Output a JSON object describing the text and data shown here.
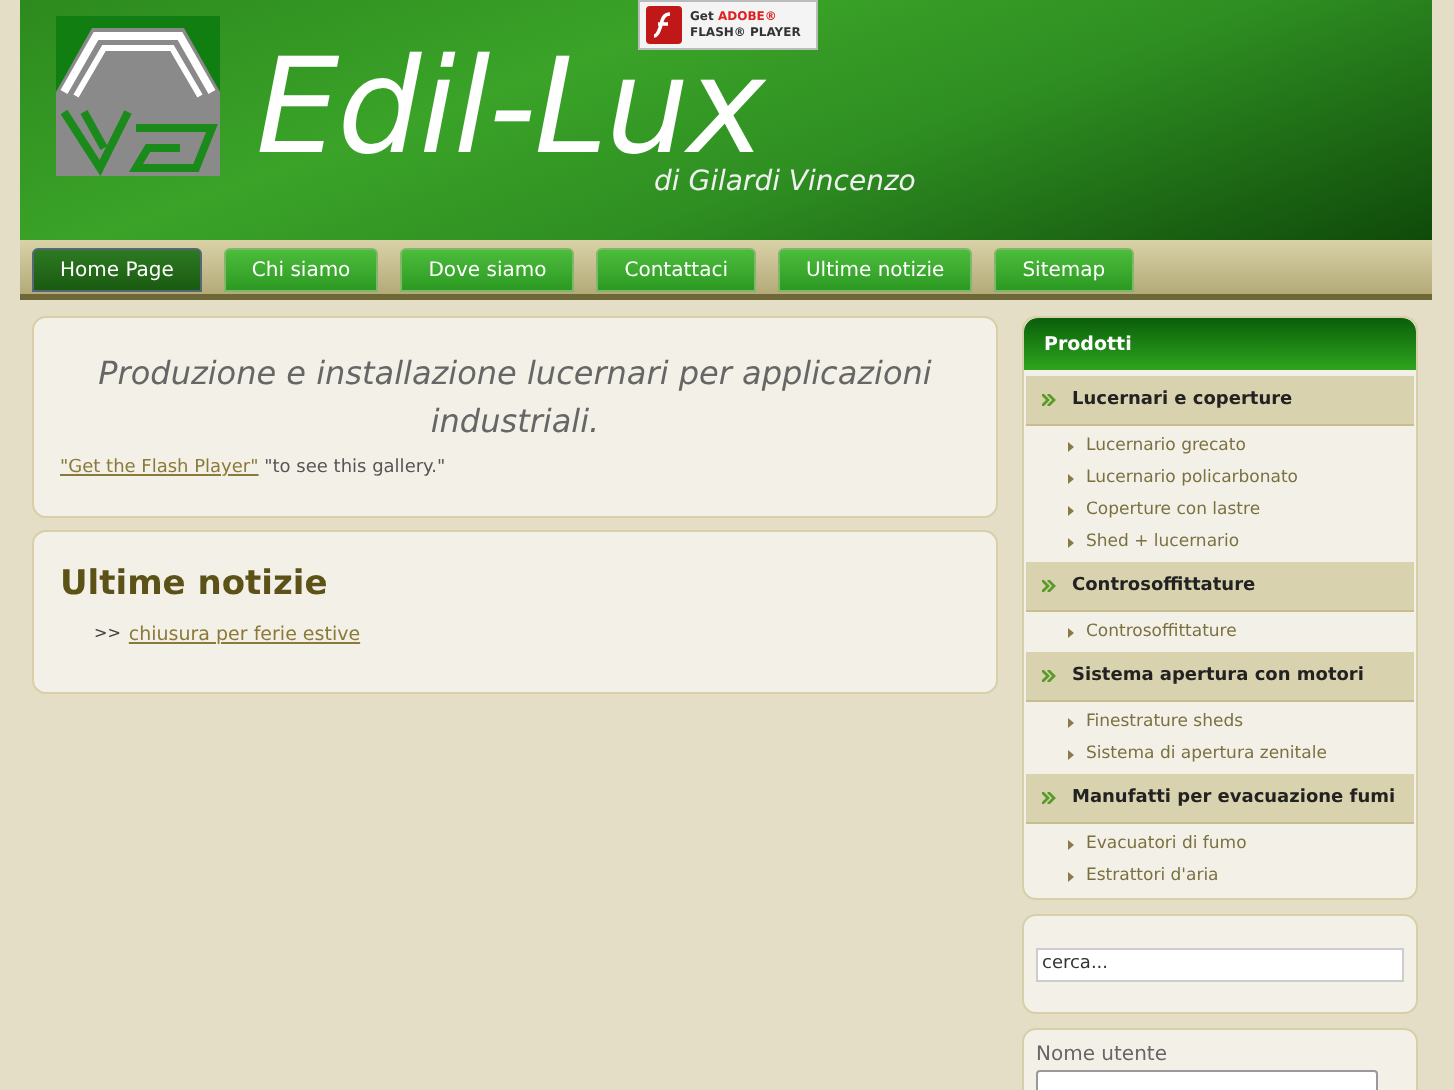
{
  "header": {
    "title": "Edil-Lux",
    "subtitle": "di Gilardi Vincenzo",
    "flash_badge": {
      "line_1_prefix": "Get",
      "line_1_brand": "ADOBE®",
      "line_2": "FLASH® PLAYER"
    }
  },
  "nav": [
    {
      "label": "Home Page",
      "selected": true
    },
    {
      "label": "Chi siamo",
      "selected": false
    },
    {
      "label": "Dove siamo",
      "selected": false
    },
    {
      "label": "Contattaci",
      "selected": false
    },
    {
      "label": "Ultime notizie",
      "selected": false
    },
    {
      "label": "Sitemap",
      "selected": false
    }
  ],
  "intro": {
    "heading": "Produzione e installazione lucernari per applicazioni industriali.",
    "flash_link": "\"Get the Flash Player\"",
    "flash_note": "\"to see this gallery.\""
  },
  "news": {
    "heading": "Ultime notizie",
    "marker": ">>",
    "items": [
      "chiusura per ferie estive"
    ]
  },
  "products": {
    "title": "Prodotti",
    "categories": [
      {
        "label": "Lucernari e coperture",
        "children": [
          "Lucernario grecato",
          "Lucernario policarbonato",
          "Coperture con lastre",
          "Shed + lucernario"
        ]
      },
      {
        "label": "Controsoffittature",
        "children": [
          "Controsoffittature"
        ]
      },
      {
        "label": "Sistema apertura con motori",
        "children": [
          "Finestrature sheds",
          "Sistema di apertura zenitale"
        ]
      },
      {
        "label": "Manufatti per evacuazione fumi",
        "children": [
          "Evacuatori di fumo",
          "Estrattori d'aria"
        ]
      }
    ]
  },
  "search": {
    "value": "cerca..."
  },
  "login": {
    "username_label": "Nome utente"
  }
}
